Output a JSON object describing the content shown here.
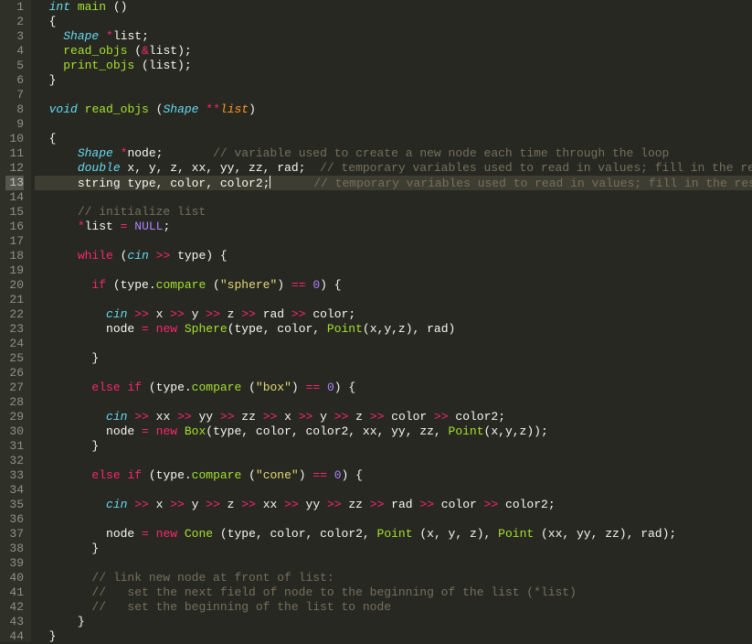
{
  "selected_line": 13,
  "lines": [
    {
      "n": 1,
      "ind": 1,
      "tokens": [
        [
          "storage",
          "int"
        ],
        [
          "plain",
          " "
        ],
        [
          "funcdef",
          "main"
        ],
        [
          "plain",
          " ()"
        ]
      ]
    },
    {
      "n": 2,
      "ind": 1,
      "tokens": [
        [
          "plain",
          "{"
        ]
      ]
    },
    {
      "n": 3,
      "ind": 2,
      "tokens": [
        [
          "type",
          "Shape"
        ],
        [
          "plain",
          " "
        ],
        [
          "op",
          "*"
        ],
        [
          "plain",
          "list;"
        ]
      ]
    },
    {
      "n": 4,
      "ind": 2,
      "tokens": [
        [
          "func",
          "read_objs"
        ],
        [
          "plain",
          " ("
        ],
        [
          "op",
          "&"
        ],
        [
          "plain",
          "list);"
        ]
      ]
    },
    {
      "n": 5,
      "ind": 2,
      "tokens": [
        [
          "func",
          "print_objs"
        ],
        [
          "plain",
          " (list);"
        ]
      ]
    },
    {
      "n": 6,
      "ind": 1,
      "tokens": [
        [
          "plain",
          "}"
        ]
      ]
    },
    {
      "n": 7,
      "ind": 0,
      "tokens": []
    },
    {
      "n": 8,
      "ind": 1,
      "tokens": [
        [
          "storage",
          "void"
        ],
        [
          "plain",
          " "
        ],
        [
          "funcdef",
          "read_objs"
        ],
        [
          "plain",
          " ("
        ],
        [
          "type",
          "Shape"
        ],
        [
          "plain",
          " "
        ],
        [
          "op",
          "**"
        ],
        [
          "param",
          "list"
        ],
        [
          "plain",
          ")"
        ]
      ]
    },
    {
      "n": 9,
      "ind": 0,
      "tokens": []
    },
    {
      "n": 10,
      "ind": 1,
      "tokens": [
        [
          "plain",
          "{"
        ]
      ]
    },
    {
      "n": 11,
      "ind": 3,
      "tokens": [
        [
          "type",
          "Shape"
        ],
        [
          "plain",
          " "
        ],
        [
          "op",
          "*"
        ],
        [
          "plain",
          "node;       "
        ],
        [
          "comment",
          "// variable used to create a new node each time through the loop"
        ]
      ]
    },
    {
      "n": 12,
      "ind": 3,
      "tokens": [
        [
          "storage",
          "double"
        ],
        [
          "plain",
          " x, y, z, xx, yy, zz, rad;  "
        ],
        [
          "comment",
          "// temporary variables used to read in values; fill in the rest"
        ]
      ]
    },
    {
      "n": 13,
      "ind": 3,
      "sel": true,
      "cursor": true,
      "tokens": [
        [
          "plain",
          "string type, color, color2;"
        ],
        [
          "cursor",
          ""
        ],
        [
          "plain",
          "      "
        ],
        [
          "comment",
          "// temporary variables used to read in values; fill in the rest"
        ]
      ]
    },
    {
      "n": 14,
      "ind": 0,
      "tokens": []
    },
    {
      "n": 15,
      "ind": 3,
      "tokens": [
        [
          "comment",
          "// initialize list"
        ]
      ]
    },
    {
      "n": 16,
      "ind": 3,
      "tokens": [
        [
          "op",
          "*"
        ],
        [
          "plain",
          "list "
        ],
        [
          "op",
          "="
        ],
        [
          "plain",
          " "
        ],
        [
          "const",
          "NULL"
        ],
        [
          "plain",
          ";"
        ]
      ]
    },
    {
      "n": 17,
      "ind": 0,
      "tokens": []
    },
    {
      "n": 18,
      "ind": 3,
      "tokens": [
        [
          "keyword",
          "while"
        ],
        [
          "plain",
          " ("
        ],
        [
          "type",
          "cin"
        ],
        [
          "plain",
          " "
        ],
        [
          "op",
          ">>"
        ],
        [
          "plain",
          " type) {"
        ]
      ]
    },
    {
      "n": 19,
      "ind": 0,
      "tokens": []
    },
    {
      "n": 20,
      "ind": 4,
      "tokens": [
        [
          "keyword",
          "if"
        ],
        [
          "plain",
          " (type."
        ],
        [
          "func",
          "compare"
        ],
        [
          "plain",
          " ("
        ],
        [
          "string",
          "\"sphere\""
        ],
        [
          "plain",
          ") "
        ],
        [
          "op",
          "=="
        ],
        [
          "plain",
          " "
        ],
        [
          "const",
          "0"
        ],
        [
          "plain",
          ") {"
        ]
      ]
    },
    {
      "n": 21,
      "ind": 0,
      "tokens": []
    },
    {
      "n": 22,
      "ind": 5,
      "tokens": [
        [
          "type",
          "cin"
        ],
        [
          "plain",
          " "
        ],
        [
          "op",
          ">>"
        ],
        [
          "plain",
          " x "
        ],
        [
          "op",
          ">>"
        ],
        [
          "plain",
          " y "
        ],
        [
          "op",
          ">>"
        ],
        [
          "plain",
          " z "
        ],
        [
          "op",
          ">>"
        ],
        [
          "plain",
          " rad "
        ],
        [
          "op",
          ">>"
        ],
        [
          "plain",
          " color;"
        ]
      ]
    },
    {
      "n": 23,
      "ind": 5,
      "tokens": [
        [
          "plain",
          "node "
        ],
        [
          "op",
          "="
        ],
        [
          "plain",
          " "
        ],
        [
          "keyword",
          "new"
        ],
        [
          "plain",
          " "
        ],
        [
          "func",
          "Sphere"
        ],
        [
          "plain",
          "(type, color, "
        ],
        [
          "func",
          "Point"
        ],
        [
          "plain",
          "(x,y,z), rad)"
        ]
      ]
    },
    {
      "n": 24,
      "ind": 0,
      "tokens": []
    },
    {
      "n": 25,
      "ind": 4,
      "tokens": [
        [
          "plain",
          "}"
        ]
      ]
    },
    {
      "n": 26,
      "ind": 0,
      "tokens": []
    },
    {
      "n": 27,
      "ind": 4,
      "tokens": [
        [
          "keyword",
          "else"
        ],
        [
          "plain",
          " "
        ],
        [
          "keyword",
          "if"
        ],
        [
          "plain",
          " (type."
        ],
        [
          "func",
          "compare"
        ],
        [
          "plain",
          " ("
        ],
        [
          "string",
          "\"box\""
        ],
        [
          "plain",
          ") "
        ],
        [
          "op",
          "=="
        ],
        [
          "plain",
          " "
        ],
        [
          "const",
          "0"
        ],
        [
          "plain",
          ") {"
        ]
      ]
    },
    {
      "n": 28,
      "ind": 0,
      "tokens": []
    },
    {
      "n": 29,
      "ind": 5,
      "tokens": [
        [
          "type",
          "cin"
        ],
        [
          "plain",
          " "
        ],
        [
          "op",
          ">>"
        ],
        [
          "plain",
          " xx "
        ],
        [
          "op",
          ">>"
        ],
        [
          "plain",
          " yy "
        ],
        [
          "op",
          ">>"
        ],
        [
          "plain",
          " zz "
        ],
        [
          "op",
          ">>"
        ],
        [
          "plain",
          " x "
        ],
        [
          "op",
          ">>"
        ],
        [
          "plain",
          " y "
        ],
        [
          "op",
          ">>"
        ],
        [
          "plain",
          " z "
        ],
        [
          "op",
          ">>"
        ],
        [
          "plain",
          " color "
        ],
        [
          "op",
          ">>"
        ],
        [
          "plain",
          " color2;"
        ]
      ]
    },
    {
      "n": 30,
      "ind": 5,
      "tokens": [
        [
          "plain",
          "node "
        ],
        [
          "op",
          "="
        ],
        [
          "plain",
          " "
        ],
        [
          "keyword",
          "new"
        ],
        [
          "plain",
          " "
        ],
        [
          "func",
          "Box"
        ],
        [
          "plain",
          "(type, color, color2, xx, yy, zz, "
        ],
        [
          "func",
          "Point"
        ],
        [
          "plain",
          "(x,y,z));"
        ]
      ]
    },
    {
      "n": 31,
      "ind": 4,
      "tokens": [
        [
          "plain",
          "}"
        ]
      ]
    },
    {
      "n": 32,
      "ind": 0,
      "tokens": []
    },
    {
      "n": 33,
      "ind": 4,
      "tokens": [
        [
          "keyword",
          "else"
        ],
        [
          "plain",
          " "
        ],
        [
          "keyword",
          "if"
        ],
        [
          "plain",
          " (type."
        ],
        [
          "func",
          "compare"
        ],
        [
          "plain",
          " ("
        ],
        [
          "string",
          "\"cone\""
        ],
        [
          "plain",
          ") "
        ],
        [
          "op",
          "=="
        ],
        [
          "plain",
          " "
        ],
        [
          "const",
          "0"
        ],
        [
          "plain",
          ") {"
        ]
      ]
    },
    {
      "n": 34,
      "ind": 0,
      "tokens": []
    },
    {
      "n": 35,
      "ind": 5,
      "tokens": [
        [
          "type",
          "cin"
        ],
        [
          "plain",
          " "
        ],
        [
          "op",
          ">>"
        ],
        [
          "plain",
          " x "
        ],
        [
          "op",
          ">>"
        ],
        [
          "plain",
          " y "
        ],
        [
          "op",
          ">>"
        ],
        [
          "plain",
          " z "
        ],
        [
          "op",
          ">>"
        ],
        [
          "plain",
          " xx "
        ],
        [
          "op",
          ">>"
        ],
        [
          "plain",
          " yy "
        ],
        [
          "op",
          ">>"
        ],
        [
          "plain",
          " zz "
        ],
        [
          "op",
          ">>"
        ],
        [
          "plain",
          " rad "
        ],
        [
          "op",
          ">>"
        ],
        [
          "plain",
          " color "
        ],
        [
          "op",
          ">>"
        ],
        [
          "plain",
          " color2;"
        ]
      ]
    },
    {
      "n": 36,
      "ind": 0,
      "tokens": []
    },
    {
      "n": 37,
      "ind": 5,
      "tokens": [
        [
          "plain",
          "node "
        ],
        [
          "op",
          "="
        ],
        [
          "plain",
          " "
        ],
        [
          "keyword",
          "new"
        ],
        [
          "plain",
          " "
        ],
        [
          "func",
          "Cone"
        ],
        [
          "plain",
          " (type, color, color2, "
        ],
        [
          "func",
          "Point"
        ],
        [
          "plain",
          " (x, y, z), "
        ],
        [
          "func",
          "Point"
        ],
        [
          "plain",
          " (xx, yy, zz), rad);"
        ]
      ]
    },
    {
      "n": 38,
      "ind": 4,
      "tokens": [
        [
          "plain",
          "}"
        ]
      ]
    },
    {
      "n": 39,
      "ind": 0,
      "tokens": []
    },
    {
      "n": 40,
      "ind": 4,
      "tokens": [
        [
          "comment",
          "// link new node at front of list:"
        ]
      ]
    },
    {
      "n": 41,
      "ind": 4,
      "tokens": [
        [
          "comment",
          "//   set the next field of node to the beginning of the list (*list)"
        ]
      ]
    },
    {
      "n": 42,
      "ind": 4,
      "tokens": [
        [
          "comment",
          "//   set the beginning of the list to node"
        ]
      ]
    },
    {
      "n": 43,
      "ind": 3,
      "tokens": [
        [
          "plain",
          "}"
        ]
      ]
    },
    {
      "n": 44,
      "ind": 1,
      "tokens": [
        [
          "plain",
          "}"
        ]
      ]
    }
  ],
  "indent_unit": "  "
}
